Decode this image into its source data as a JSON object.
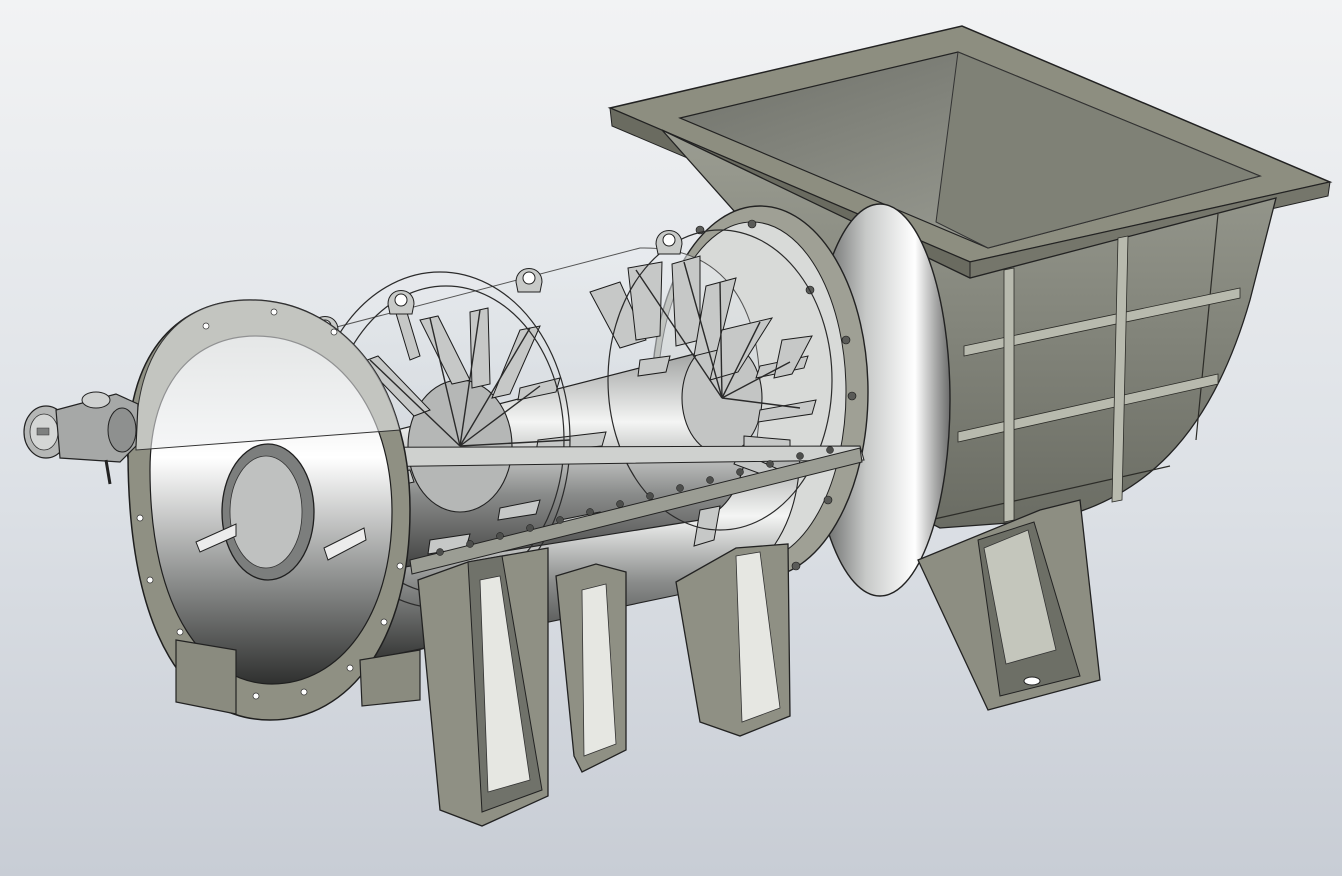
{
  "viewport": {
    "view_type": "3d-cad-model",
    "background_colors": [
      "#f2f3f4",
      "#c8cdd5"
    ]
  },
  "model": {
    "material_colors": {
      "painted_steel": "#8b8c7e",
      "painted_steel_dark": "#5f6156",
      "stainless_light": "#e4e6e6",
      "stainless_dark": "#3e3f3e",
      "transparent_shell": "#c9d3dc",
      "edge_line": "#202020"
    },
    "side_support_legs": 3,
    "hopper_panels": 9,
    "visible_paddles": 24
  }
}
